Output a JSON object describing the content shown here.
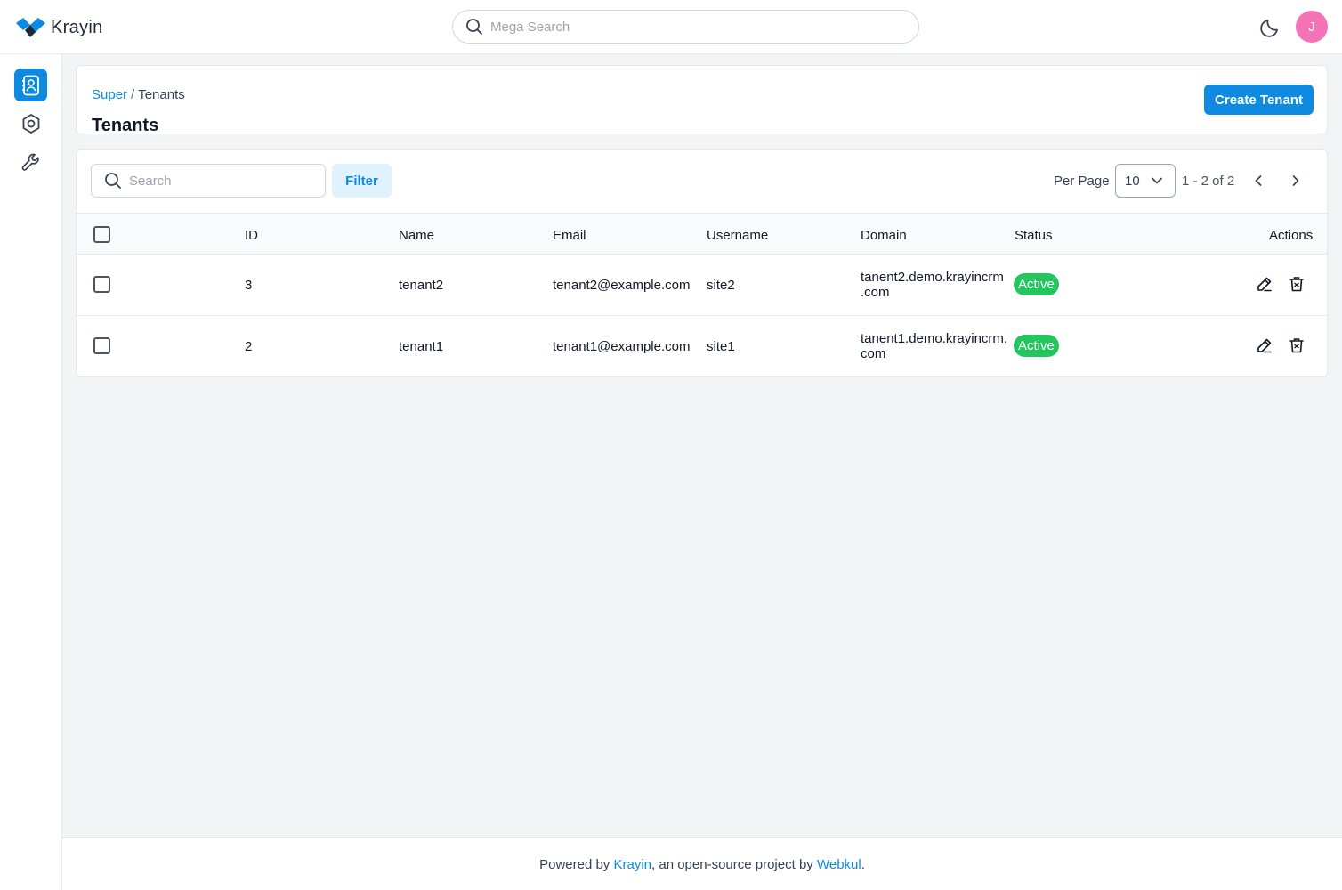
{
  "header": {
    "logo_text": "Krayin",
    "mega_search_placeholder": "Mega Search",
    "avatar_initial": "J",
    "avatar_color": "#f472b6"
  },
  "sidebar": {
    "items": [
      {
        "name": "contacts",
        "active": true
      },
      {
        "name": "settings",
        "active": false
      },
      {
        "name": "configuration",
        "active": false
      }
    ]
  },
  "breadcrumb": {
    "parent": "Super",
    "separator": "/",
    "current": "Tenants"
  },
  "page": {
    "title": "Tenants",
    "create_button": "Create Tenant"
  },
  "toolbar": {
    "search_placeholder": "Search",
    "filter_label": "Filter",
    "per_page_label": "Per Page",
    "per_page_value": "10",
    "pagination_text": "1 - 2 of 2"
  },
  "table": {
    "columns": [
      "ID",
      "Name",
      "Email",
      "Username",
      "Domain",
      "Status",
      "Actions"
    ],
    "rows": [
      {
        "id": "3",
        "name": "tenant2",
        "email": "tenant2@example.com",
        "username": "site2",
        "domain_line1": "tanent2.demo.krayincrm",
        "domain_line2": ".com",
        "status": "Active"
      },
      {
        "id": "2",
        "name": "tenant1",
        "email": "tenant1@example.com",
        "username": "site1",
        "domain_line1": "tanent1.demo.krayincrm.",
        "domain_line2": "com",
        "status": "Active"
      }
    ]
  },
  "footer": {
    "prefix": "Powered by ",
    "link1": "Krayin",
    "middle": ", an open-source project by ",
    "link2": "Webkul",
    "suffix": "."
  },
  "colors": {
    "primary": "#0e8be0",
    "active_badge": "#22c55e",
    "background": "#f3f4f6"
  }
}
